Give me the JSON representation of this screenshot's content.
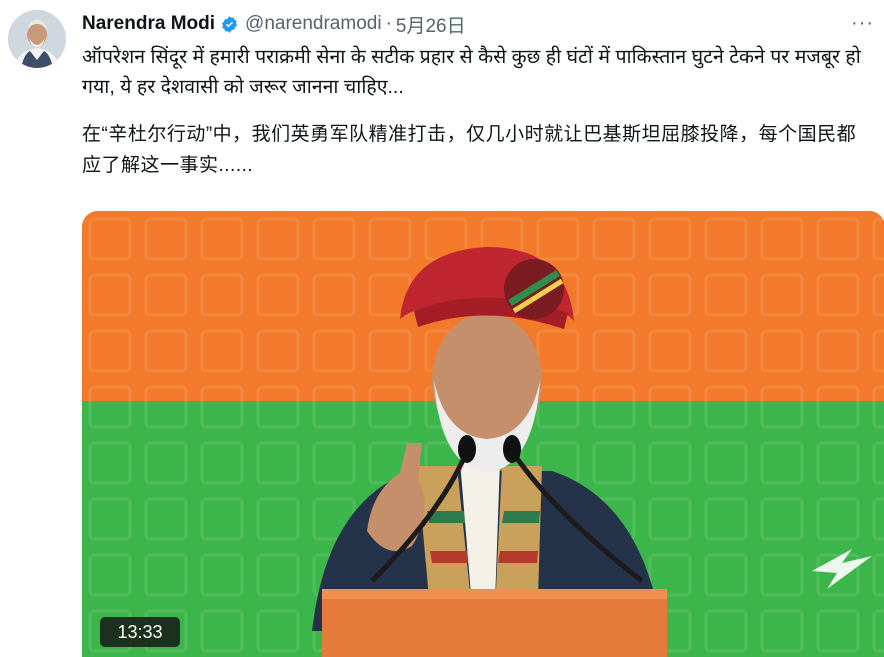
{
  "tweet": {
    "author": {
      "name": "Narendra Modi",
      "handle": "@narendramodi",
      "verified": true,
      "verified_color": "#1d9bf0"
    },
    "separator": "·",
    "date": "5月26日",
    "more_label": "···",
    "text_hindi": "ऑपरेशन सिंदूर में हमारी पराक्रमी सेना के सटीक प्रहार से कैसे कुछ ही घंटों में पाकिस्तान घुटने टेकने पर मजबूर हो गया, ये हर देशवासी को जरूर जानना चाहिए...",
    "text_translation": "在“辛杜尔行动”中，我们英勇军队精准打击，仅几小时就让巴基斯坦屈膝投降，每个国民都应了解这一事实......",
    "media": {
      "type": "video",
      "duration": "13:33",
      "colors": {
        "saffron": "#f27a2a",
        "green": "#3cb54a"
      }
    }
  },
  "icons": {
    "verified": "verified-badge-icon",
    "more": "more-options-icon"
  }
}
